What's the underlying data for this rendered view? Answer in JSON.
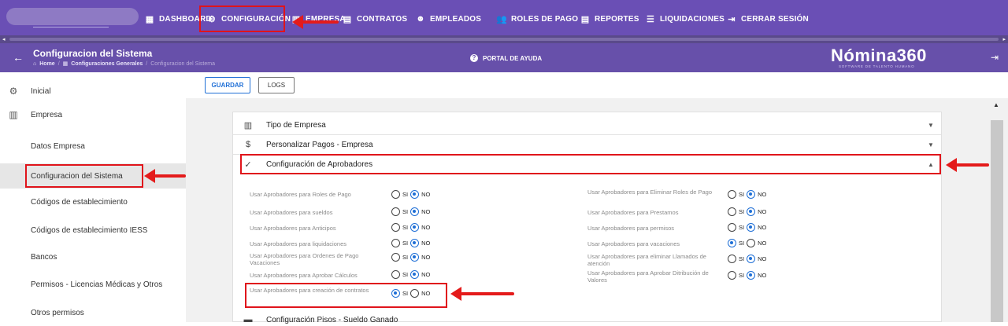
{
  "nav": {
    "items": [
      {
        "label": "DASHBOARD",
        "icon": "dashboard-icon"
      },
      {
        "label": "CONFIGURACIÓN",
        "icon": "gear-icon"
      },
      {
        "label": "EMPRESA",
        "icon": "building-icon"
      },
      {
        "label": "CONTRATOS",
        "icon": "contract-icon"
      },
      {
        "label": "EMPLEADOS",
        "icon": "employee-icon"
      },
      {
        "label": "ROLES DE PAGO",
        "icon": "users-icon"
      },
      {
        "label": "REPORTES",
        "icon": "report-icon"
      },
      {
        "label": "LIQUIDACIONES",
        "icon": "list-icon"
      },
      {
        "label": "CERRAR SESIÓN",
        "icon": "logout-icon"
      }
    ]
  },
  "header": {
    "title": "Configuracion del Sistema",
    "breadcrumbs": [
      "Home",
      "Configuraciones Generales",
      "Configuracion del Sistema"
    ],
    "portal": "PORTAL DE AYUDA",
    "logo": "Nómina360",
    "logo_sub": "SOFTWARE DE TALENTO HUMANO"
  },
  "sidebar": {
    "items": [
      {
        "label": "Inicial",
        "icon": "gear-icon"
      },
      {
        "label": "Empresa",
        "icon": "building-icon"
      },
      {
        "label": "Datos Empresa"
      },
      {
        "label": "Configuracion del Sistema"
      },
      {
        "label": "Códigos de establecimiento"
      },
      {
        "label": "Códigos de establecimiento IESS"
      },
      {
        "label": "Bancos"
      },
      {
        "label": "Permisos - Licencias Médicas y Otros"
      },
      {
        "label": "Otros permisos"
      }
    ]
  },
  "toolbar": {
    "save": "GUARDAR",
    "logs": "LOGS"
  },
  "accordion": {
    "sections": [
      {
        "label": "Tipo de Empresa",
        "icon": "building-icon"
      },
      {
        "label": "Personalizar Pagos - Empresa",
        "icon": "dollar-icon"
      },
      {
        "label": "Configuración de Aprobadores",
        "icon": "check-icon"
      },
      {
        "label": "Configuración Pisos - Sueldo Ganado",
        "icon": "calendar-icon"
      }
    ]
  },
  "radio": {
    "si": "SI",
    "no": "NO"
  },
  "options_left": [
    {
      "label": "Usar Aprobadores para Roles de Pago",
      "value": "NO"
    },
    {
      "label": "Usar Aprobadores para sueldos",
      "value": "NO"
    },
    {
      "label": "Usar Aprobadores para Anticipos",
      "value": "NO"
    },
    {
      "label": "Usar Aprobadores para liquidaciones",
      "value": "NO"
    },
    {
      "label": "Usar Aprobadores para Ordenes de Pago Vacaciones",
      "value": "NO"
    },
    {
      "label": "Usar Aprobadores para Aprobar Cálculos",
      "value": "NO"
    },
    {
      "label": "Usar Aprobadores para creación de contratos",
      "value": "SI"
    }
  ],
  "options_right": [
    {
      "label": "Usar Aprobadores para Eliminar Roles de Pago",
      "value": "NO"
    },
    {
      "label": "Usar Aprobadores para Prestamos",
      "value": "NO"
    },
    {
      "label": "Usar Aprobadores para permisos",
      "value": "NO"
    },
    {
      "label": "Usar Aprobadores para vacaciones",
      "value": "SI"
    },
    {
      "label": "Usar Aprobadores para eliminar Llamados de atención",
      "value": "NO"
    },
    {
      "label": "Usar Aprobadores para Aprobar Ditribución de Valores",
      "value": "NO"
    }
  ]
}
